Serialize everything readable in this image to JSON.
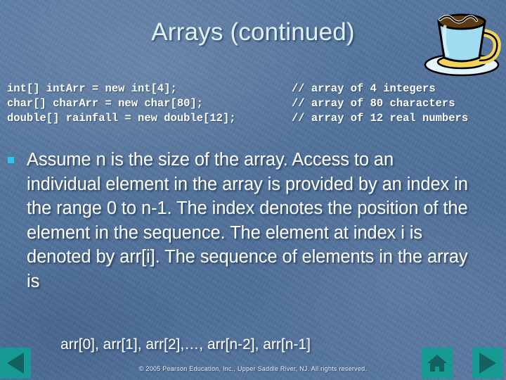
{
  "slide": {
    "title": "Arrays (continued)",
    "code_lines": [
      {
        "declaration": "int[] intArr = new int[4];",
        "comment": "// array of 4 integers"
      },
      {
        "declaration": "char[] charArr = new char[80];",
        "comment": "// array of 80 characters"
      },
      {
        "declaration": "double[] rainfall = new double[12];",
        "comment": "// array of 12 real numbers"
      }
    ],
    "bullet_text": "Assume n is the size of the array. Access to an individual element in the array is provided by an index in the range 0 to n-1. The index denotes the position of the element in the sequence.  The element at index i is denoted by arr[i]. The sequence of elements in the array is",
    "array_sequence": "arr[0], arr[1], arr[2],…, arr[n-2], arr[n-1]",
    "copyright": "© 2005 Pearson Education, Inc., Upper Saddle River, NJ.  All rights reserved."
  },
  "navigation": {
    "previous_label": "Previous slide",
    "home_label": "Home",
    "next_label": "Next slide"
  },
  "decoration": {
    "coffee_cup_label": "Java coffee cup"
  },
  "colors": {
    "background": "#52739c",
    "title": "#dff1f8",
    "body_text": "#ffffff",
    "bullet_marker": "#2ec6ef",
    "nav_button": "#179a94",
    "nav_glyph": "#14615f",
    "cup_body": "#9fdcf0",
    "cup_accent": "#f2d25a",
    "coffee": "#5b3a14"
  }
}
